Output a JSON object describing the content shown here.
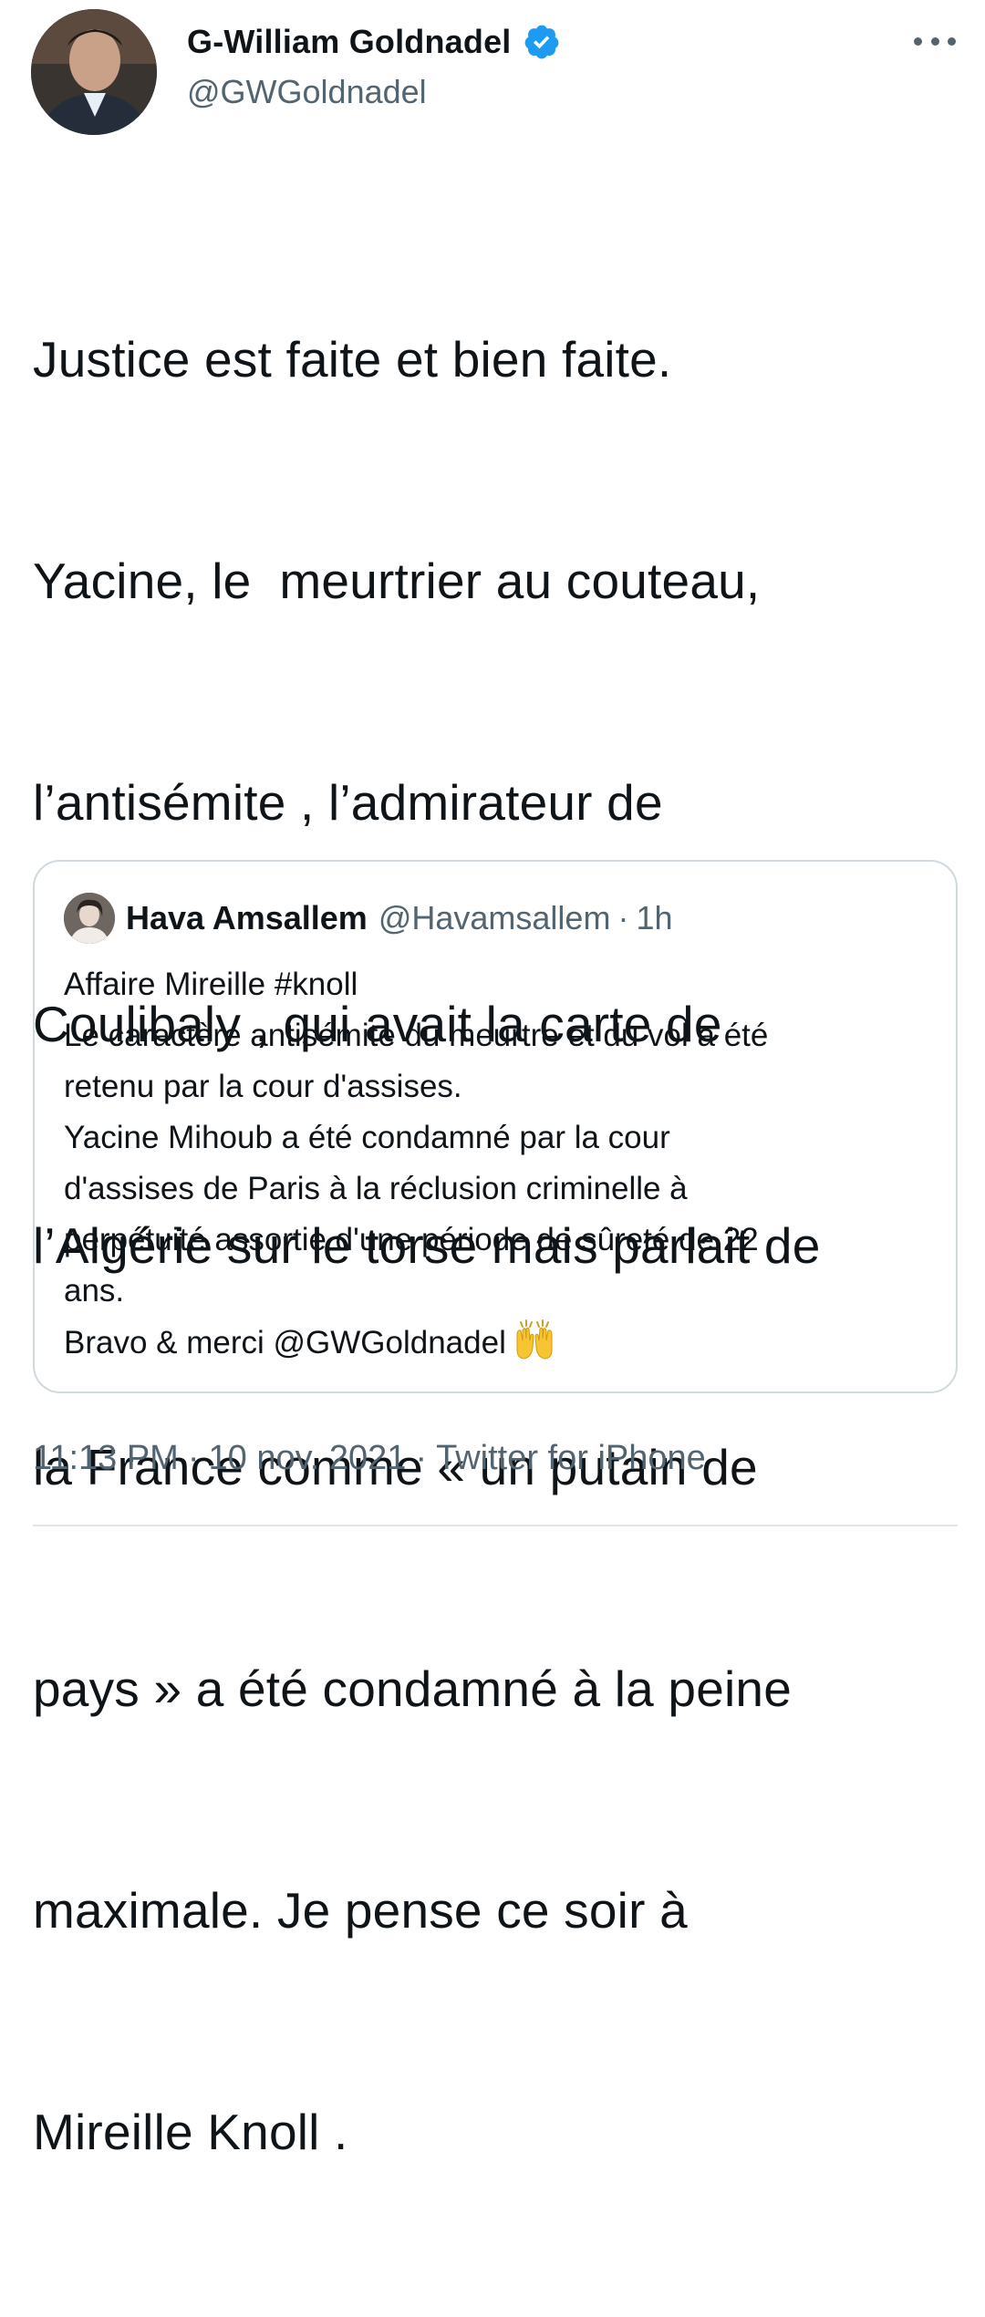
{
  "author": {
    "name": "G-William Goldnadel",
    "handle": "@GWGoldnadel",
    "verified": true,
    "verified_color": "#1d9bf0"
  },
  "tweet": {
    "text_lines": [
      "Justice est faite et bien faite.",
      "Yacine, le  meurtrier au couteau,",
      "l’antisémite , l’admirateur de",
      "Coulibaly , qui avait la carte de",
      "l’Algérie sur le torse mais parlait de",
      "la France comme « un putain de",
      "pays » a été condamné à la peine",
      "maximale. Je pense ce soir à",
      "Mireille Knoll ."
    ]
  },
  "quote": {
    "author_name": "Hava Amsallem",
    "author_handle": "@Havamsallem",
    "separator": "·",
    "time": "1h",
    "text_lines": [
      "Affaire Mireille #knoll",
      "Le caractère antisémite du meurtre et du vol a été",
      "retenu par la cour d'assises.",
      "Yacine Mihoub a été condamné par la cour",
      "d'assises de Paris à la réclusion criminelle à",
      "perpétuité assortie d'une période de sûreté de 22",
      "ans.",
      "Bravo & merci @GWGoldnadel"
    ],
    "trailing_emoji": "raised-hands-icon"
  },
  "meta": {
    "time": "11:13 PM",
    "separator": "·",
    "date": "10 nov. 2021",
    "source": "Twitter for iPhone"
  },
  "colors": {
    "text": "#0f1419",
    "secondary_text": "#536471",
    "border": "#cfd9de",
    "accent": "#1d9bf0"
  }
}
